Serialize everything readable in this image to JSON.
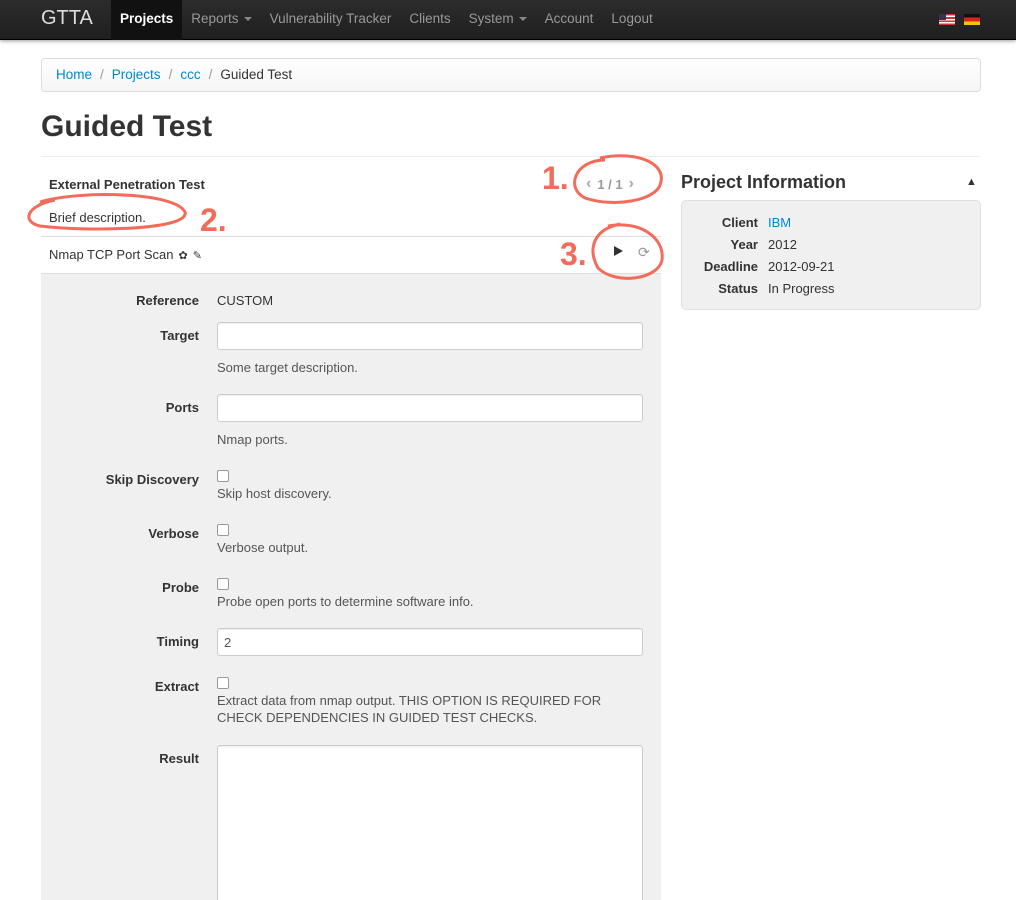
{
  "nav": {
    "brand": "GTTA",
    "items": [
      {
        "label": "Projects",
        "active": true,
        "dropdown": false
      },
      {
        "label": "Reports",
        "active": false,
        "dropdown": true
      },
      {
        "label": "Vulnerability Tracker",
        "active": false,
        "dropdown": false
      },
      {
        "label": "Clients",
        "active": false,
        "dropdown": false
      },
      {
        "label": "System",
        "active": false,
        "dropdown": true
      },
      {
        "label": "Account",
        "active": false,
        "dropdown": false
      },
      {
        "label": "Logout",
        "active": false,
        "dropdown": false
      }
    ],
    "flags": [
      "us-flag-icon",
      "de-flag-icon"
    ]
  },
  "breadcrumb": {
    "items": [
      "Home",
      "Projects",
      "ccc"
    ],
    "current": "Guided Test",
    "separator": "/"
  },
  "page": {
    "title": "Guided Test"
  },
  "test": {
    "name": "External Penetration Test",
    "description": "Brief description.",
    "pager": "1 / 1"
  },
  "check": {
    "name": "Nmap TCP Port Scan",
    "fields": {
      "reference": {
        "label": "Reference",
        "value": "CUSTOM"
      },
      "target": {
        "label": "Target",
        "value": "",
        "help": "Some target description."
      },
      "ports": {
        "label": "Ports",
        "value": "",
        "help": "Nmap ports."
      },
      "skip_discovery": {
        "label": "Skip Discovery",
        "checked": false,
        "help": "Skip host discovery."
      },
      "verbose": {
        "label": "Verbose",
        "checked": false,
        "help": "Verbose output."
      },
      "probe": {
        "label": "Probe",
        "checked": false,
        "help": "Probe open ports to determine software info."
      },
      "timing": {
        "label": "Timing",
        "value": "2"
      },
      "extract": {
        "label": "Extract",
        "checked": false,
        "help": "Extract data from nmap output. THIS OPTION IS REQUIRED FOR CHECK DEPENDENCIES IN GUIDED TEST CHECKS."
      },
      "result": {
        "label": "Result",
        "value": ""
      }
    }
  },
  "project_info": {
    "title": "Project Information",
    "client_label": "Client",
    "client": "IBM",
    "year_label": "Year",
    "year": "2012",
    "deadline_label": "Deadline",
    "deadline": "2012-09-21",
    "status_label": "Status",
    "status": "In Progress"
  },
  "annotations": {
    "one": "1.",
    "two": "2.",
    "three": "3."
  },
  "colors": {
    "link": "#0088cc",
    "annotation": "#f26b5b",
    "navbar": "#222222"
  }
}
